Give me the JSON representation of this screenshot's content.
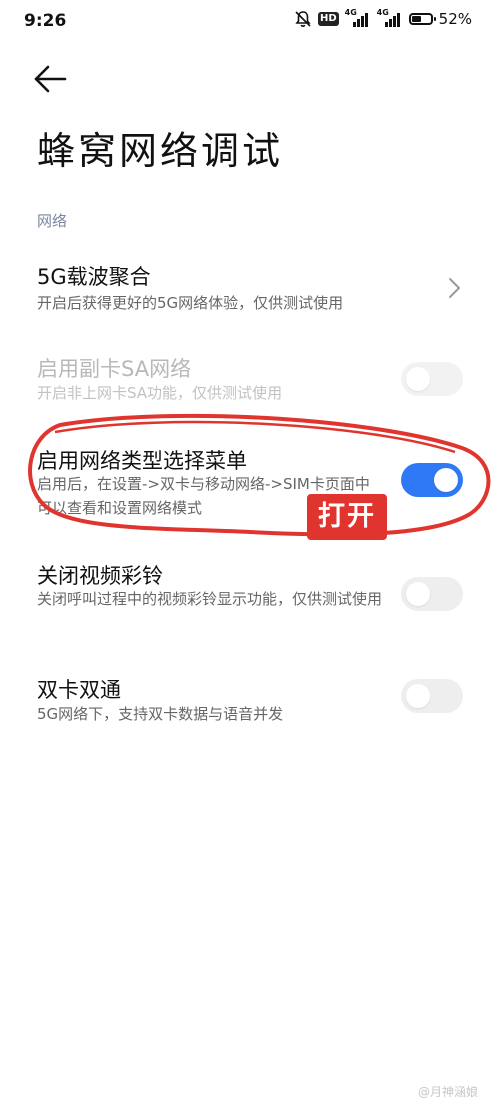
{
  "status_bar": {
    "time": "9:26",
    "network_badge": "HD",
    "signal1_label": "4G",
    "signal2_label": "4G",
    "battery_percent": "52%",
    "battery_level": 0.52,
    "icons": [
      "mute-bell-icon",
      "hd-icon",
      "signal-icon",
      "signal-icon",
      "battery-icon"
    ]
  },
  "header": {
    "back_icon": "arrow-left-icon",
    "title": "蜂窝网络调试"
  },
  "section": {
    "label": "网络"
  },
  "settings": [
    {
      "title": "5G载波聚合",
      "subtitle": "开启后获得更好的5G网络体验，仅供测试使用",
      "control": "chevron",
      "enabled": true
    },
    {
      "title": "启用副卡SA网络",
      "subtitle": "开启非上网卡SA功能，仅供测试使用",
      "control": "toggle",
      "state": "off",
      "enabled": false
    },
    {
      "title": "启用网络类型选择菜单",
      "subtitle": "启用后，在设置->双卡与移动网络->SIM卡页面中可以查看和设置网络模式",
      "control": "toggle",
      "state": "on",
      "enabled": true
    },
    {
      "title": "关闭视频彩铃",
      "subtitle": "关闭呼叫过程中的视频彩铃显示功能，仅供测试使用",
      "control": "toggle",
      "state": "off",
      "enabled": true
    },
    {
      "title": "双卡双通",
      "subtitle": "5G网络下，支持双卡数据与语音并发",
      "control": "toggle",
      "state": "off",
      "enabled": true
    }
  ],
  "annotation": {
    "label": "打开",
    "color": "#e0352f"
  },
  "watermark": "@月神涵娘",
  "colors": {
    "accent": "#2f79f6",
    "section": "#7a86a0"
  }
}
